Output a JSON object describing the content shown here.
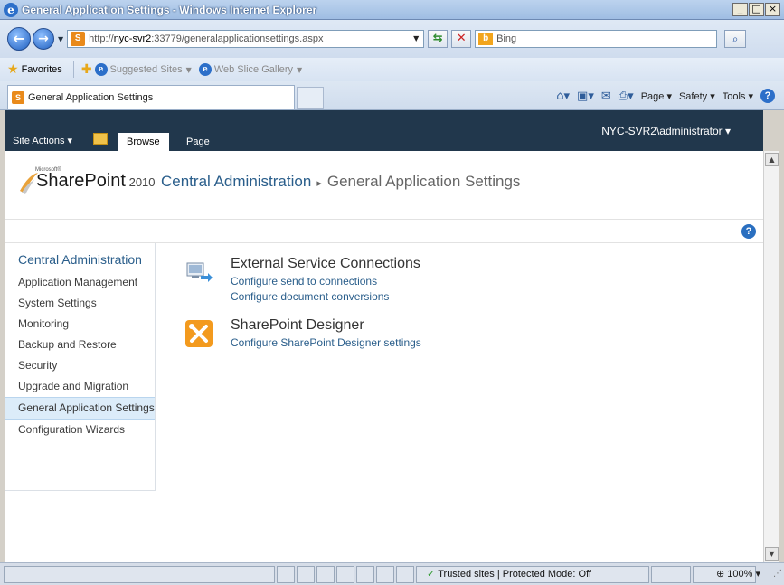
{
  "window": {
    "title": "General Application Settings - Windows Internet Explorer",
    "minimize": "_",
    "maximize": "□",
    "close": "×"
  },
  "address": {
    "url_prefix": "http://",
    "url_host": "nyc-svr2",
    "url_rest": ":33779/generalapplicationsettings.aspx",
    "search_placeholder": "Bing"
  },
  "favorites_bar": {
    "favorites": "Favorites",
    "suggested_sites": "Suggested Sites",
    "web_slice_gallery": "Web Slice Gallery"
  },
  "tab": {
    "label": "General Application Settings"
  },
  "commands": {
    "page": "Page",
    "safety": "Safety",
    "tools": "Tools"
  },
  "ribbon": {
    "site_actions": "Site Actions",
    "tabs": [
      {
        "label": "Browse",
        "active": true
      },
      {
        "label": "Page",
        "active": false
      }
    ],
    "user": "NYC-SVR2\\administrator"
  },
  "logo": {
    "microsoft": "Microsoft®",
    "brand": "SharePoint",
    "version": "2010"
  },
  "breadcrumb": {
    "root": "Central Administration",
    "separator": "▸",
    "current": "General Application Settings"
  },
  "quick_launch": {
    "heading": "Central Administration",
    "items": [
      {
        "label": "Application Management"
      },
      {
        "label": "System Settings"
      },
      {
        "label": "Monitoring"
      },
      {
        "label": "Backup and Restore"
      },
      {
        "label": "Security"
      },
      {
        "label": "Upgrade and Migration"
      },
      {
        "label": "General Application Settings",
        "selected": true
      },
      {
        "label": "Configuration Wizards"
      }
    ]
  },
  "groups": [
    {
      "title": "External Service Connections",
      "links": [
        "Configure send to connections",
        "Configure document conversions"
      ]
    },
    {
      "title": "SharePoint Designer",
      "links": [
        "Configure SharePoint Designer settings"
      ]
    }
  ],
  "status": {
    "zone": "Trusted sites | Protected Mode: Off",
    "zoom": "100%"
  },
  "colors": {
    "ribbon_bg": "#21374c",
    "link": "#2a5e8b",
    "selected_nav": "#dcecf9"
  }
}
